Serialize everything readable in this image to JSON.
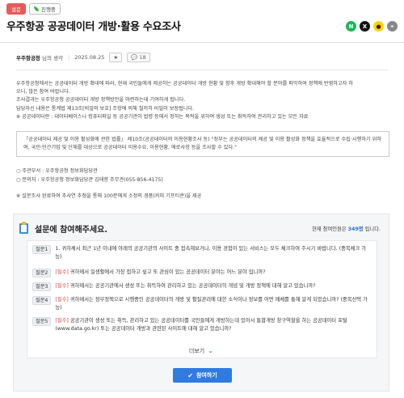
{
  "header": {
    "category_badge": "설문",
    "status_badge": "진행중",
    "title": "우주항공 공공데이터 개방·활용 수요조사"
  },
  "share": {
    "icons": [
      "naver-icon",
      "x-icon",
      "kakao-icon",
      "link-icon"
    ],
    "naver_glyph": "N",
    "x_glyph": "X",
    "kakao_glyph": "●",
    "link_glyph": "⚭"
  },
  "meta": {
    "org": "우주항공청",
    "org_suffix": "님의 생각",
    "date": "2025.08.25",
    "star_glyph": "★",
    "comment_glyph": "💬",
    "comment_count": "18"
  },
  "body": {
    "lines": [
      "우주항공청에서는 공공데이터 개방 확대에 따라, 현재 국민들에게 제공하는 공공데이터 개방 현황 및 향후 개방 확대해야 할 분야를 파악하여 정책에 반영하고자 하",
      "오니, 많은 참여 바랍니다.",
      "조사결과는 우주항공청 공공데이터 개방 정책방안을 마련하는데 기여하게 됩니다.",
      "답당자신 내용은 통계법 제13조[비밀의 보호] 조항에 의해 철저히 비밀이 보장됩니다.",
      "※ 공공데이터란 : 데이터베이스나 컴퓨터파일 등 공공기관이 법령 등에서 정하는 목적을 위하여 생성 또는 취득하여 관리하고 있는 모든 자료"
    ],
    "quote": "「공공데이터 제공 및 이용 활성화에 관한 법률」 제10조(공공데이터의 이용현황조사 등) \"정부는 공공데이터의 제공 및 이용 활성화 정책을 효율적으로 수립·시행하기 위하여, 국민·민간기업 및 단체를 대상으로 공공데이터 이용수요, 이용현황, 애로사항 등을 조사할 수 있다.\"",
    "contact_dept": "○ 주관부서 : 우주항공청 정보화담당관",
    "contact_person": "○ 문의처 : 우주항공청 정보화담당관 김태향 주무관(055-856-4175)",
    "note": "※ 설문조사 완료하여 추사연 추첨을 통해 100분에게 소정의 경품(커피 기프티콘)을 제공"
  },
  "survey": {
    "panel_title": "설문에 참여해주세요.",
    "participants_prefix": "현재 참여인원은",
    "participants_count": "349명",
    "participants_suffix": "입니다.",
    "questions": [
      {
        "label": "질문1",
        "required": "",
        "text": "1. 귀하께서 최근 1년 이내에 아래의 공공기관의 사이트 중 접속해보거나, 이용 경험이 있는 서비스는 모두 체크하여 주시기 바랍니다. (중복체크 가능)"
      },
      {
        "label": "질문2",
        "required": "[필수]",
        "text": " 귀하께서 일생활에서 가장 접하고 싶고 또 관심이 있는 공공데이터 분야는 어느 분야 입니까?"
      },
      {
        "label": "질문3",
        "required": "[필수]",
        "text": " 귀하께서는 공공기관에서 생성 또는 취득하여 관리하고 있는 공공데이터의 개념 및 개방 정책에 대해 알고 있습니까?"
      },
      {
        "label": "질문4",
        "required": "[필수]",
        "text": " 귀하께서는 정부정책으로 시행중인 공공데이터의 개방 및 활질관리에 대한 소식이나 정보를 어떤 매체를 통해 알게 되었습니까? (중복선택 가능)"
      },
      {
        "label": "질문5",
        "required": "[필수]",
        "text": " 공공기관이 생성 또는 취득, 관리하고 있는 공공데이터를 국민들에게 개방하는데 있어서 통합개방 창구역할을 하는 공공데이터 포털(www.data.go.kr) 또는 공공데이터 개방과 관련된 사이트에 대해 알고 있습니까?"
      }
    ],
    "more_label": "더보기",
    "more_glyph": "⌄",
    "join_glyph": "✔",
    "join_label": "참여하기"
  }
}
